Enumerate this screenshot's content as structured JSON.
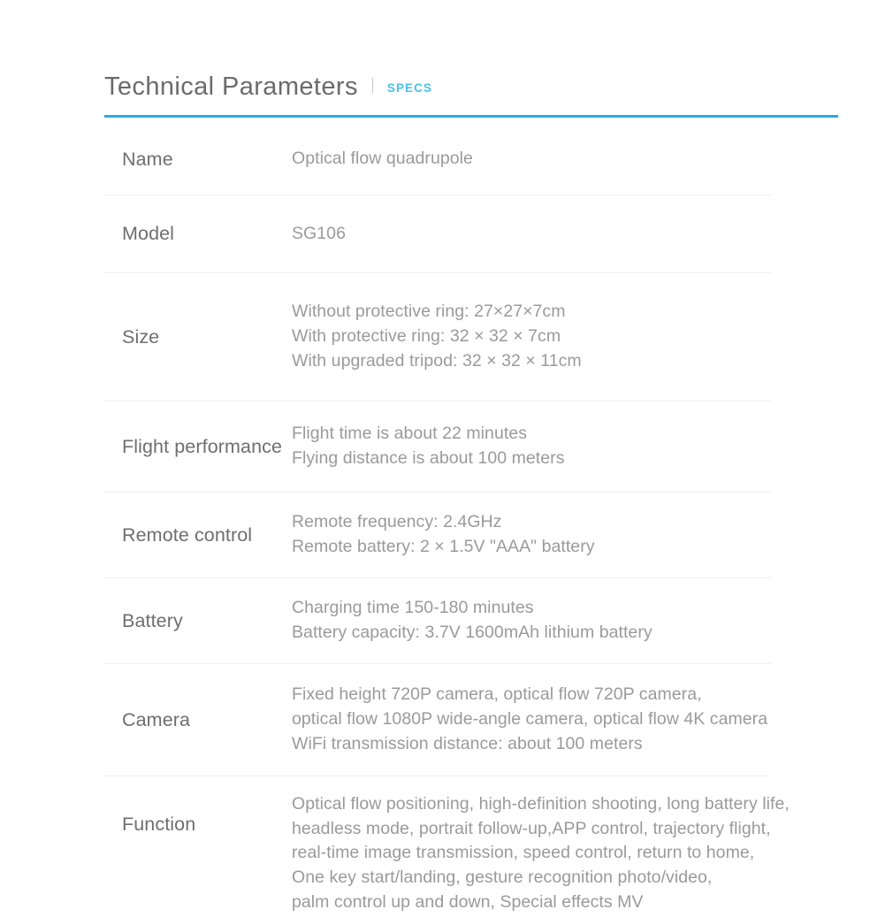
{
  "header": {
    "title": "Technical Parameters",
    "divider_glyph": "|",
    "tag": "SPECS",
    "rule_color": "#29abe2",
    "tag_color": "#4bc0e8"
  },
  "table": {
    "rows": [
      {
        "label": "Name",
        "value": "Optical flow quadrupole"
      },
      {
        "label": "Model",
        "value": "SG106"
      },
      {
        "label": "Size",
        "value": "Without protective ring: 27×27×7cm\nWith protective ring: 32 × 32 × 7cm\nWith upgraded tripod: 32 × 32 × 11cm"
      },
      {
        "label": "Flight performance",
        "value": "Flight time is about 22 minutes\nFlying distance is about 100 meters"
      },
      {
        "label": "Remote control",
        "value": "Remote frequency: 2.4GHz\nRemote battery: 2 × 1.5V \"AAA\" battery"
      },
      {
        "label": "Battery",
        "value": "Charging time 150-180 minutes\nBattery capacity: 3.7V 1600mAh lithium battery"
      },
      {
        "label": "Camera",
        "value": "Fixed height 720P camera, optical flow 720P camera,\noptical flow 1080P wide-angle camera, optical flow 4K camera\nWiFi transmission distance: about 100 meters"
      },
      {
        "label": "Function",
        "value": "Optical flow positioning, high-definition shooting, long battery life,\nheadless mode, portrait follow-up,APP control, trajectory flight,\nreal-time image transmission, speed control, return to home,\nOne key start/landing, gesture recognition photo/video,\npalm control up and down, Special effects MV"
      }
    ]
  }
}
